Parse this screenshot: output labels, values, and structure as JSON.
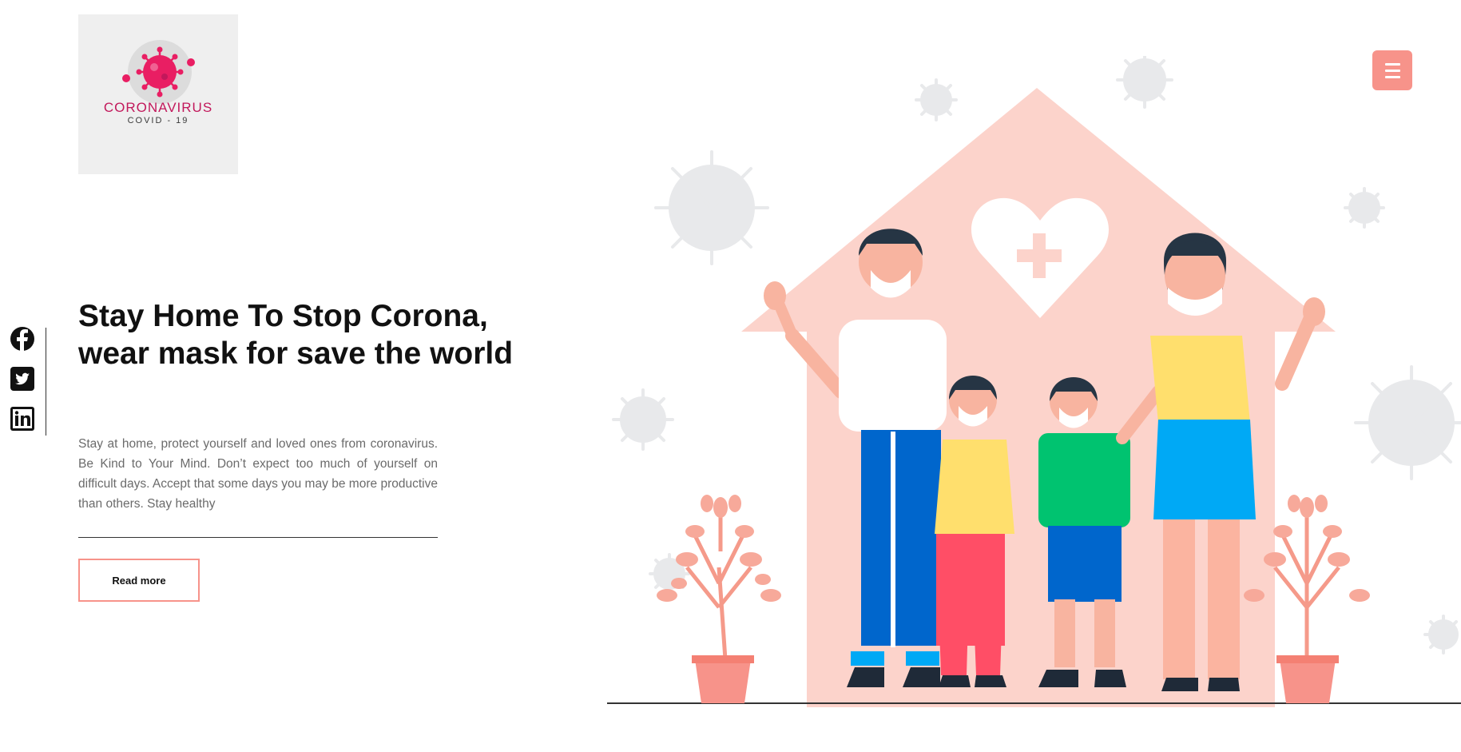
{
  "logo": {
    "main": "CORONAVIRUS",
    "sub": "COVID - 19",
    "icon": "virus-logo-icon"
  },
  "menu": {
    "icon": "hamburger-icon"
  },
  "social": [
    {
      "name": "facebook",
      "icon": "facebook-icon"
    },
    {
      "name": "twitter",
      "icon": "twitter-icon"
    },
    {
      "name": "linkedin",
      "icon": "linkedin-icon"
    }
  ],
  "hero": {
    "title": "Stay Home To Stop Corona, wear mask for save the world",
    "text": "Stay at home, protect yourself and loved ones from coronavirus. Be Kind to Your Mind. Don’t expect too much of yourself on difficult days. Accept that some days you may be more productive than others. Stay healthy",
    "button": "Read more"
  },
  "colors": {
    "accent": "#f7938a",
    "house": "#fcd3cb",
    "virus_gray": "#e8e9eb",
    "logo_red": "#e91e63"
  }
}
